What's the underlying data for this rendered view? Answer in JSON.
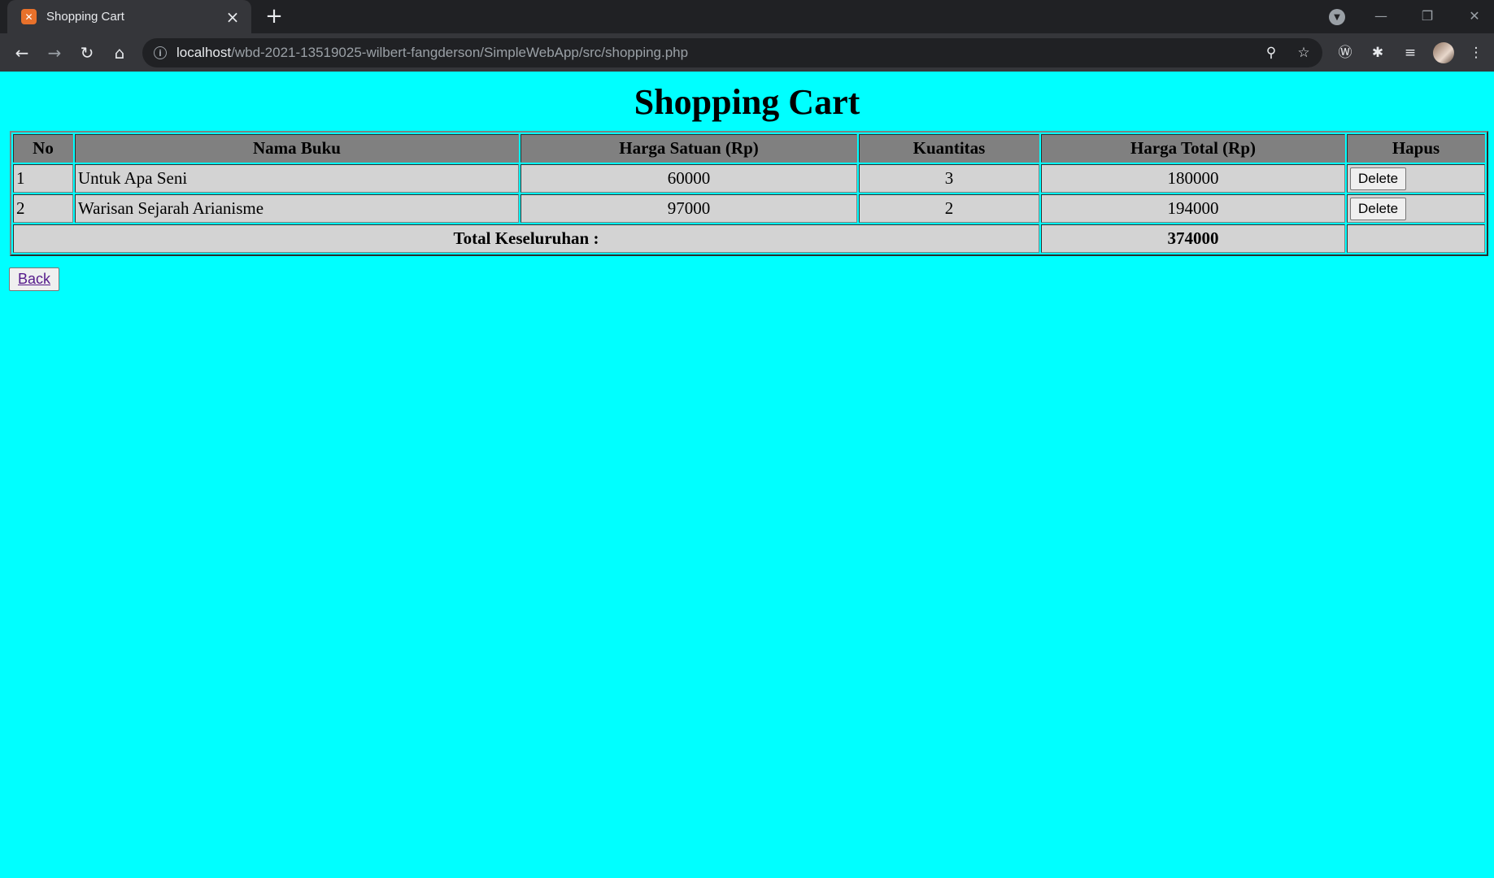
{
  "browser": {
    "tab_title": "Shopping Cart",
    "tab_favicon": "xampp-icon",
    "url_host": "localhost",
    "url_path": "/wbd-2021-13519025-wilbert-fangderson/SimpleWebApp/src/shopping.php"
  },
  "page": {
    "title": "Shopping Cart",
    "background": "#00ffff"
  },
  "table": {
    "headers": [
      "No",
      "Nama Buku",
      "Harga Satuan (Rp)",
      "Kuantitas",
      "Harga Total (Rp)",
      "Hapus"
    ],
    "rows": [
      {
        "no": "1",
        "name": "Untuk Apa Seni",
        "unit_price": "60000",
        "qty": "3",
        "total": "180000",
        "action": "Delete"
      },
      {
        "no": "2",
        "name": "Warisan Sejarah Arianisme",
        "unit_price": "97000",
        "qty": "2",
        "total": "194000",
        "action": "Delete"
      }
    ],
    "grand_total_label": "Total Keseluruhan :",
    "grand_total_value": "374000"
  },
  "back_link": "Back"
}
